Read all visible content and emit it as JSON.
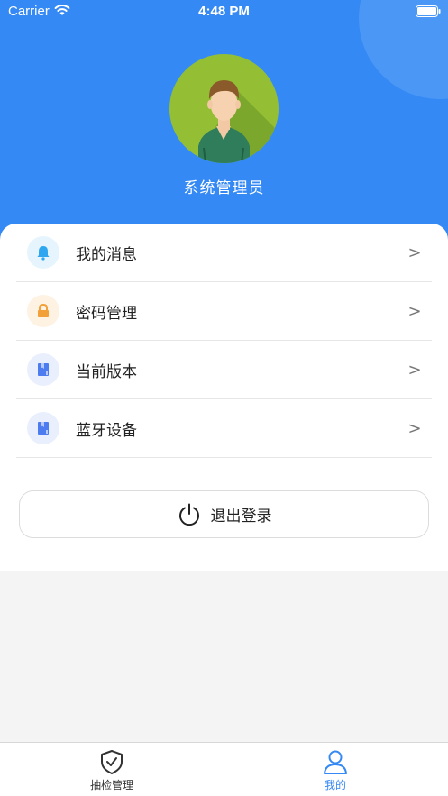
{
  "status_bar": {
    "carrier": "Carrier",
    "time": "4:48 PM"
  },
  "profile": {
    "name": "系统管理员"
  },
  "menu": {
    "items": [
      {
        "label": "我的消息",
        "icon": "bell-icon",
        "icon_color": "#2ea7f0",
        "icon_bg": "#e6f5fd",
        "arrow": ">"
      },
      {
        "label": "密码管理",
        "icon": "lock-icon",
        "icon_color": "#f2a03a",
        "icon_bg": "#fef2e3",
        "arrow": ">"
      },
      {
        "label": "当前版本",
        "icon": "version-icon",
        "icon_color": "#4d7cf0",
        "icon_bg": "#e9effd",
        "arrow": ">"
      },
      {
        "label": "蓝牙设备",
        "icon": "bluetooth-device-icon",
        "icon_color": "#4d7cf0",
        "icon_bg": "#e9effd",
        "arrow": ">"
      }
    ]
  },
  "logout": {
    "label": "退出登录"
  },
  "tabbar": {
    "tabs": [
      {
        "label": "抽检管理",
        "icon": "shield-check-icon",
        "active": false
      },
      {
        "label": "我的",
        "icon": "user-icon",
        "active": true
      }
    ],
    "active_color": "#3589f4",
    "inactive_color": "#333333"
  },
  "colors": {
    "header": "#3589f4",
    "avatar_bg": "#94bf35"
  }
}
